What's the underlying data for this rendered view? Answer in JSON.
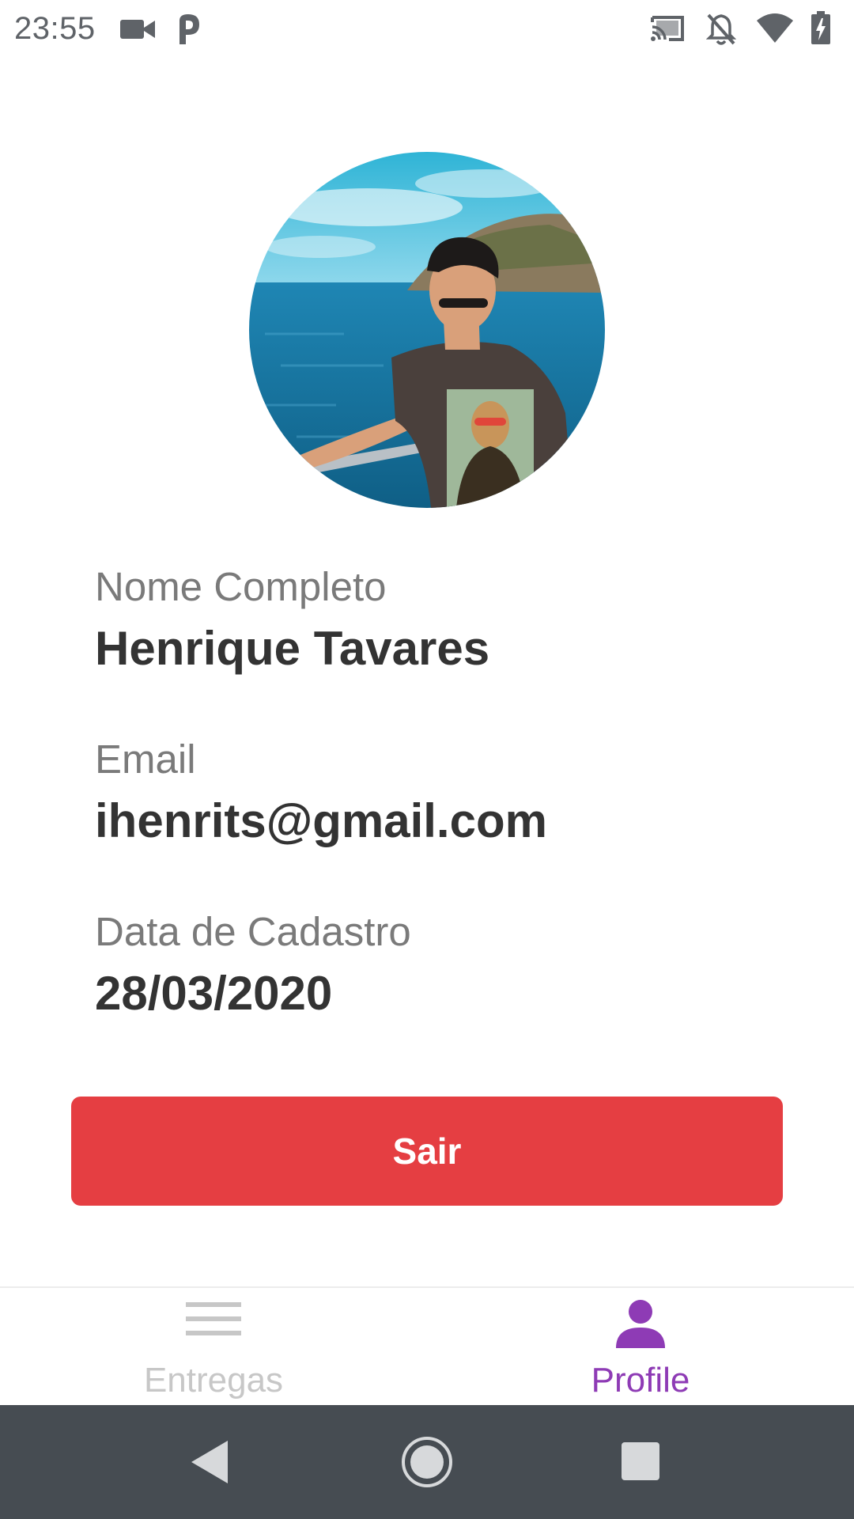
{
  "status_bar": {
    "time": "23:55",
    "left_icons": [
      "video-camera-icon",
      "p-icon"
    ],
    "right_icons": [
      "cast-icon",
      "notifications-off-icon",
      "wifi-icon",
      "battery-charging-icon"
    ]
  },
  "profile": {
    "avatar": "profile-photo",
    "fields": [
      {
        "label": "Nome Completo",
        "value": "Henrique Tavares"
      },
      {
        "label": "Email",
        "value": "ihenrits@gmail.com"
      },
      {
        "label": "Data de Cadastro",
        "value": "28/03/2020"
      }
    ],
    "logout_label": "Sair"
  },
  "tabs": [
    {
      "label": "Entregas",
      "icon": "menu-icon",
      "active": false
    },
    {
      "label": "Profile",
      "icon": "person-icon",
      "active": true
    }
  ],
  "nav_bar": {
    "buttons": [
      "back-icon",
      "home-icon",
      "recents-icon"
    ]
  },
  "colors": {
    "accent": "#8e3bb5",
    "logout": "#e53e42",
    "tab_inactive": "#c7c7c7",
    "nav_bar": "#464c52"
  }
}
